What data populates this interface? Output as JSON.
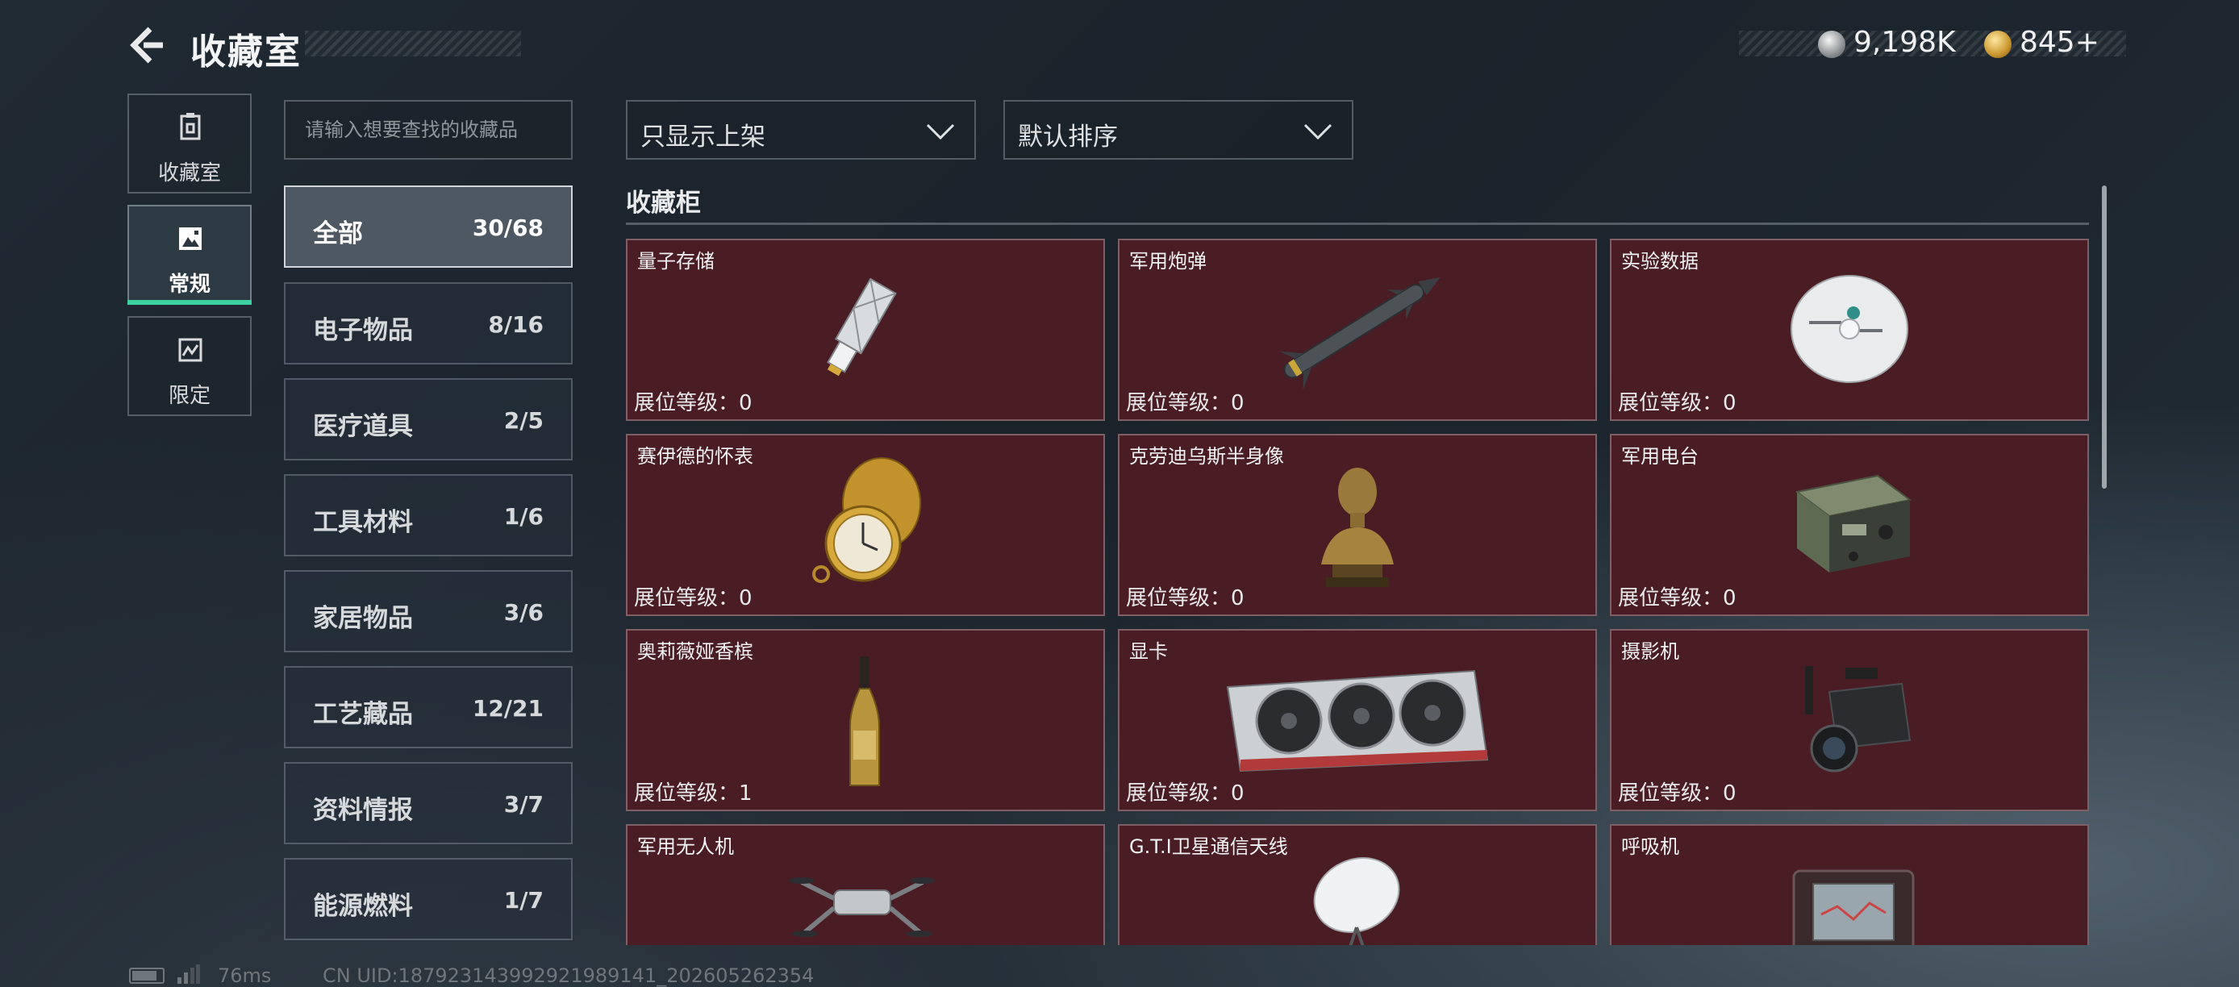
{
  "header": {
    "title": "收藏室",
    "currency_silver": "9,198K",
    "currency_gold": "845+"
  },
  "nav": {
    "items": [
      {
        "label": "收藏室",
        "icon": "collection-icon"
      },
      {
        "label": "常规",
        "icon": "regular-icon"
      },
      {
        "label": "限定",
        "icon": "limited-icon"
      }
    ],
    "selected": "常规",
    "active_color": "#3ed1a0"
  },
  "search": {
    "placeholder": "请输入想要查找的收藏品"
  },
  "categories": [
    {
      "name": "全部",
      "count": "30/68"
    },
    {
      "name": "电子物品",
      "count": "8/16"
    },
    {
      "name": "医疗道具",
      "count": "2/5"
    },
    {
      "name": "工具材料",
      "count": "1/6"
    },
    {
      "name": "家居物品",
      "count": "3/6"
    },
    {
      "name": "工艺藏品",
      "count": "12/21"
    },
    {
      "name": "资料情报",
      "count": "3/7"
    },
    {
      "name": "能源燃料",
      "count": "1/7"
    }
  ],
  "filters": {
    "show_filter": "只显示上架",
    "sort": "默认排序"
  },
  "section_title": "收藏柜",
  "card_color": "#4a1d24",
  "items": [
    {
      "name": "量子存储",
      "level": "展位等级：0",
      "icon": "usb-drive-icon"
    },
    {
      "name": "军用炮弹",
      "level": "展位等级：0",
      "icon": "missile-icon"
    },
    {
      "name": "实验数据",
      "level": "展位等级：0",
      "icon": "disc-icon"
    },
    {
      "name": "赛伊德的怀表",
      "level": "展位等级：0",
      "icon": "pocket-watch-icon"
    },
    {
      "name": "克劳迪乌斯半身像",
      "level": "展位等级：0",
      "icon": "bust-statue-icon"
    },
    {
      "name": "军用电台",
      "level": "展位等级：0",
      "icon": "radio-icon"
    },
    {
      "name": "奥莉薇娅香槟",
      "level": "展位等级：1",
      "icon": "champagne-bottle-icon"
    },
    {
      "name": "显卡",
      "level": "展位等级：0",
      "icon": "graphics-card-icon"
    },
    {
      "name": "摄影机",
      "level": "展位等级：0",
      "icon": "camera-icon"
    },
    {
      "name": "军用无人机",
      "level": "",
      "icon": "drone-icon"
    },
    {
      "name": "G.T.I卫星通信天线",
      "level": "",
      "icon": "satellite-dish-icon"
    },
    {
      "name": "呼吸机",
      "level": "",
      "icon": "ventilator-icon"
    }
  ],
  "status": {
    "ping": "76ms",
    "uid": "CN UID:1879231439929219891​41_202605262354"
  }
}
